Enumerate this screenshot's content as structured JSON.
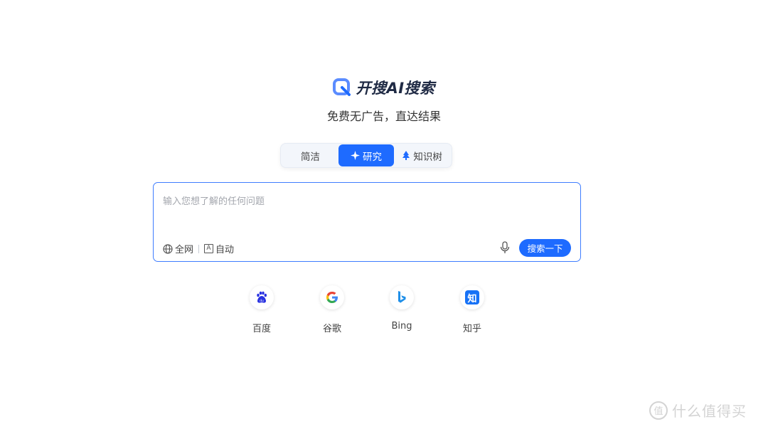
{
  "brand": {
    "name": "开搜AI搜索",
    "tagline": "免费无广告，直达结果",
    "accent": "#1e6bff"
  },
  "modes": [
    {
      "label": "简洁",
      "icon": "",
      "active": false
    },
    {
      "label": "研究",
      "icon": "sparkle-icon",
      "active": true
    },
    {
      "label": "知识树",
      "icon": "tree-icon",
      "active": false
    }
  ],
  "search": {
    "placeholder": "输入您想了解的任何问题",
    "value": "",
    "scope_label": "全网",
    "lang_label": "自动",
    "lang_icon_letter": "A",
    "submit_label": "搜索一下"
  },
  "engines": [
    {
      "label": "百度",
      "icon": "baidu-icon"
    },
    {
      "label": "谷歌",
      "icon": "google-icon"
    },
    {
      "label": "Bing",
      "icon": "bing-icon"
    },
    {
      "label": "知乎",
      "icon": "zhihu-icon",
      "glyph": "知"
    }
  ],
  "watermark": {
    "text": "什么值得买",
    "badge": "值"
  }
}
